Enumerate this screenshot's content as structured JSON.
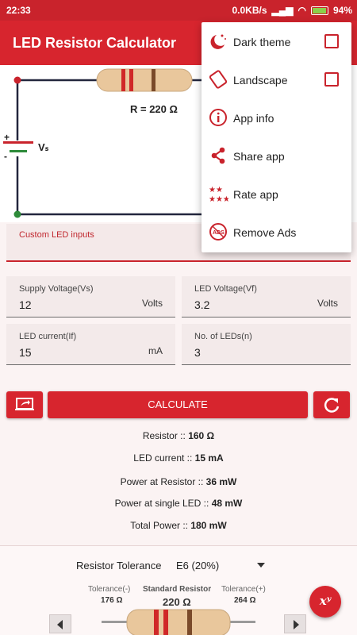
{
  "status_bar": {
    "time": "22:33",
    "speed": "0.0KB/s",
    "battery": "94%"
  },
  "app": {
    "title": "LED Resistor Calculator"
  },
  "circuit": {
    "resistor_label": "R = 220 Ω",
    "plus": "+",
    "minus": "-",
    "source_label": "Vₛ"
  },
  "custom_inputs": {
    "label": "Custom LED inputs"
  },
  "fields": {
    "supply": {
      "label": "Supply Voltage(Vs)",
      "value": "12",
      "unit": "Volts"
    },
    "led_voltage": {
      "label": "LED Voltage(Vf)",
      "value": "3.2",
      "unit": "Volts"
    },
    "led_current": {
      "label": "LED current(If)",
      "value": "15",
      "unit": "mA"
    },
    "num_leds": {
      "label": "No. of LEDs(n)",
      "value": "3"
    }
  },
  "buttons": {
    "calculate": "CALCULATE"
  },
  "results": {
    "resistor": {
      "label": "Resistor :: ",
      "value": "160 Ω"
    },
    "led_current": {
      "label": "LED current :: ",
      "value": "15 mA"
    },
    "power_resistor": {
      "label": "Power at Resistor :: ",
      "value": "36 mW"
    },
    "power_led": {
      "label": "Power at single LED :: ",
      "value": "48 mW"
    },
    "total_power": {
      "label": "Total Power :: ",
      "value": "180 mW"
    }
  },
  "tolerance": {
    "label": "Resistor Tolerance",
    "selected": "E6 (20%)",
    "minus_label": "Tolerance(-)",
    "minus_value": "176 Ω",
    "standard_label": "Standard Resistor",
    "standard_value": "220 Ω",
    "plus_label": "Tolerance(+)",
    "plus_value": "264 Ω"
  },
  "fab": {
    "label": "xʸ"
  },
  "menu": {
    "items": [
      {
        "label": "Dark theme",
        "icon": "moon-stars-icon",
        "checkbox": true,
        "checked": false
      },
      {
        "label": "Landscape",
        "icon": "rotate-screen-icon",
        "checkbox": true,
        "checked": false
      },
      {
        "label": "App info",
        "icon": "info-icon",
        "checkbox": false
      },
      {
        "label": "Share app",
        "icon": "share-icon",
        "checkbox": false
      },
      {
        "label": "Rate app",
        "icon": "stars-icon",
        "checkbox": false
      },
      {
        "label": "Remove Ads",
        "icon": "no-ads-icon",
        "checkbox": false
      }
    ]
  },
  "colors": {
    "primary": "#d7252e",
    "status_bar": "#c9232c",
    "background": "#fbf3f3"
  }
}
